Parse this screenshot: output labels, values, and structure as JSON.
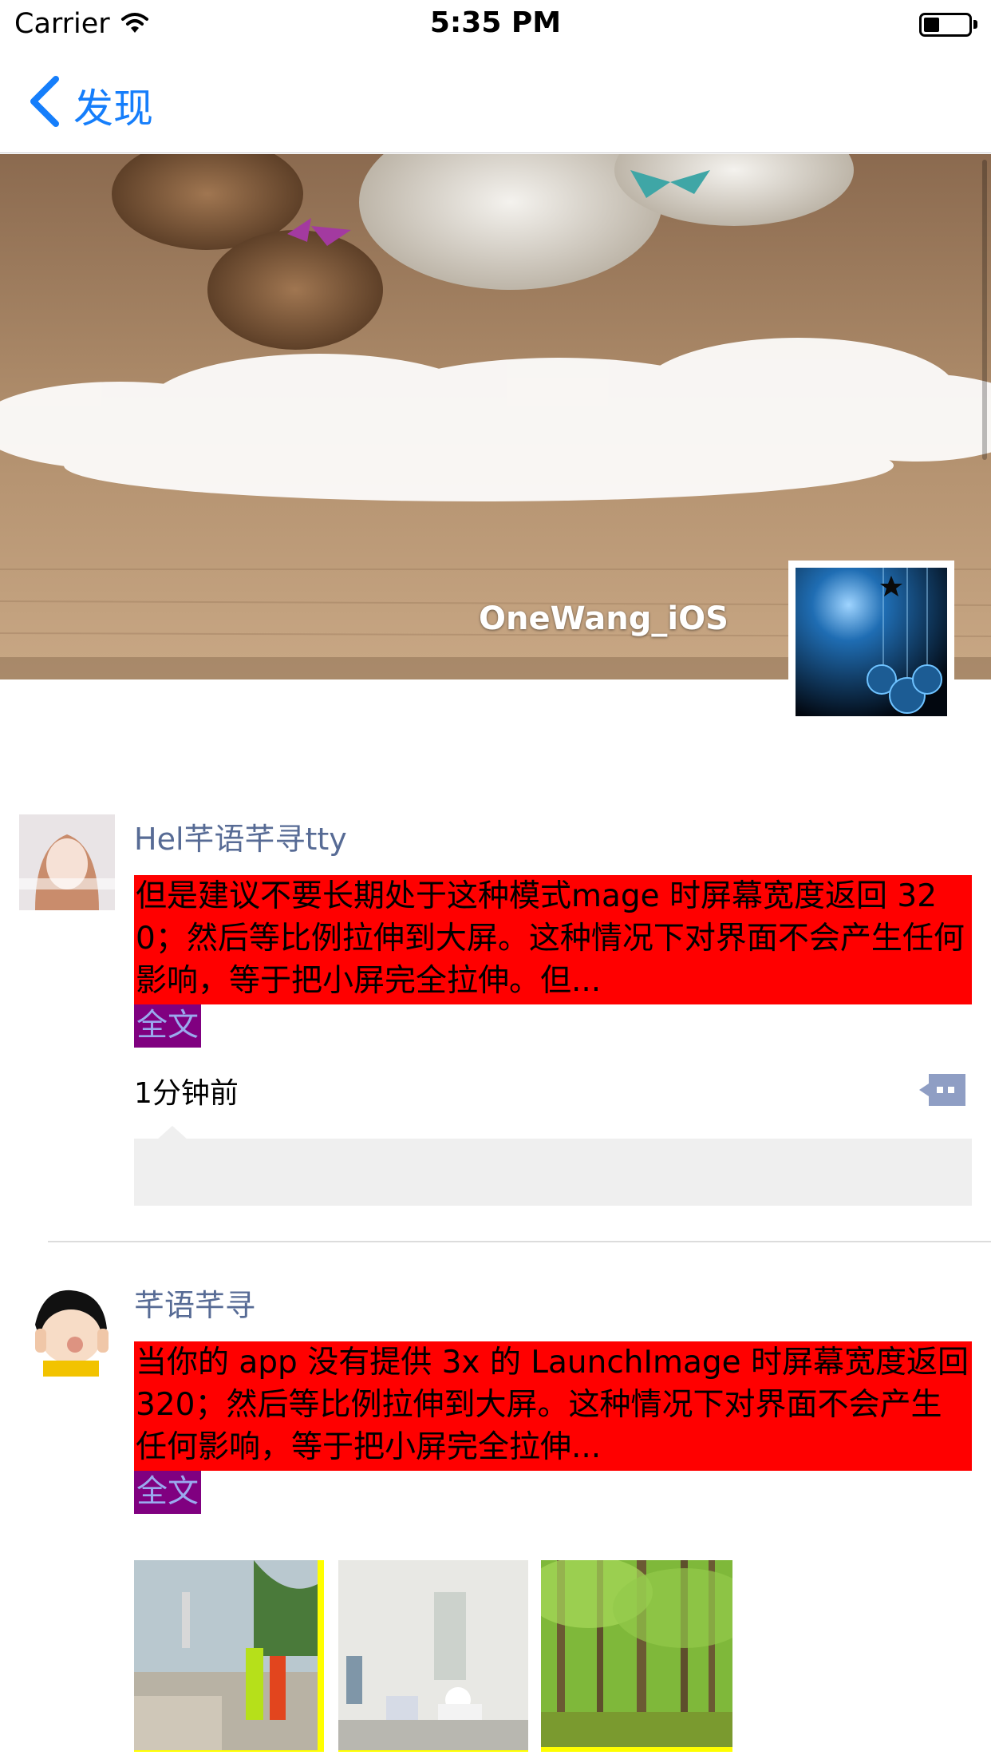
{
  "status_bar": {
    "carrier": "Carrier",
    "time": "5:35 PM",
    "battery_level": 0.35
  },
  "nav": {
    "back_label": "发现"
  },
  "profile": {
    "username": "OneWang_iOS"
  },
  "posts": [
    {
      "name": "Hel芊语芊寻tty",
      "text": "但是建议不要长期处于这种模式mage 时屏幕宽度返回 320；然后等比例拉伸到大屏。这种情况下对界面不会产生任何影响，等于把小屏完全拉伸。但...",
      "fulltext_label": "全文",
      "time": "1分钟前"
    },
    {
      "name": "芊语芊寻",
      "text": "当你的 app 没有提供 3x 的 LaunchImage 时屏幕宽度返回 320；然后等比例拉伸到大屏。这种情况下对界面不会产生任何影响，等于把小屏完全拉伸...",
      "fulltext_label": "全文"
    }
  ],
  "colors": {
    "nav_tint": "#157efb",
    "name_color": "#576b95",
    "text_highlight": "#ff0000",
    "fulltext_bg": "#800080",
    "photo_border": "#ffff00"
  },
  "icons": [
    "wifi-icon",
    "battery-icon",
    "back-chevron-icon",
    "comment-icon"
  ]
}
